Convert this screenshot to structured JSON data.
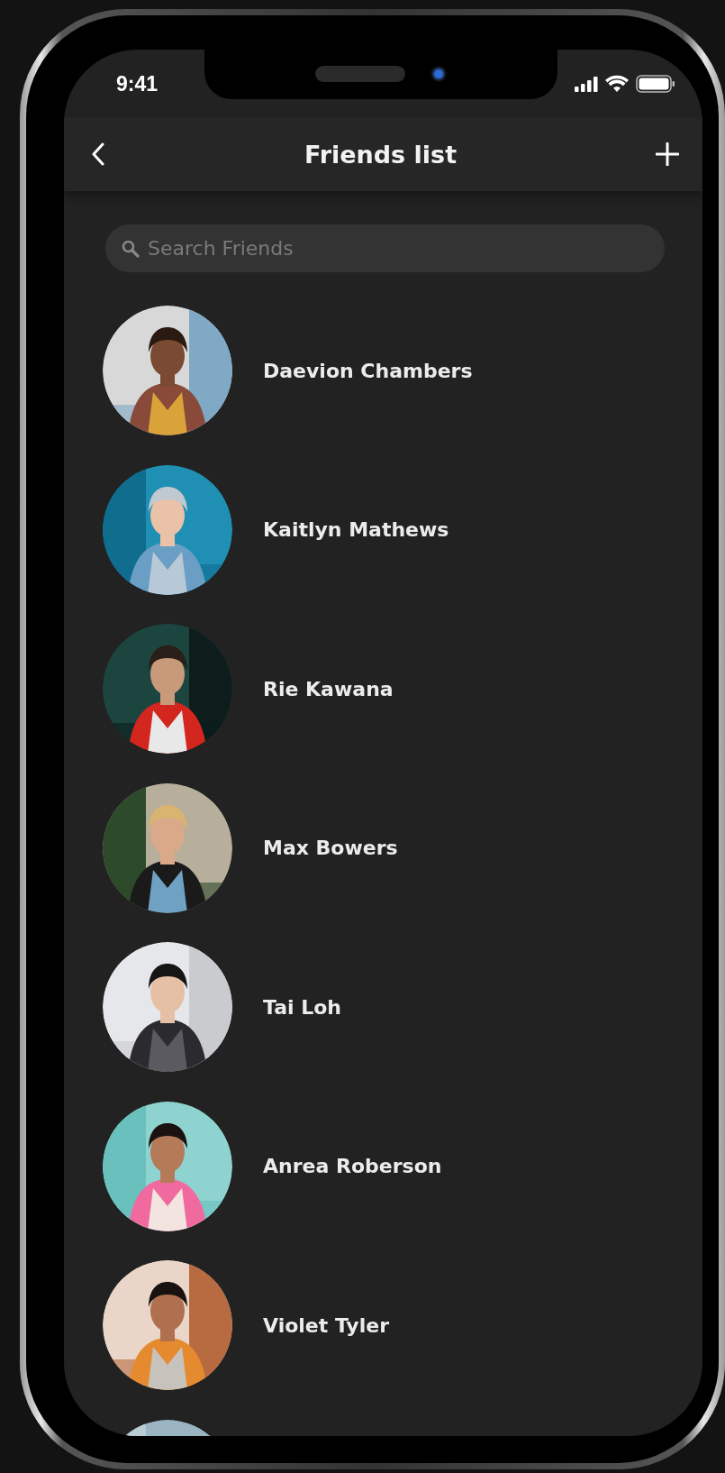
{
  "status_bar": {
    "time": "9:41"
  },
  "nav_bar": {
    "title": "Friends list"
  },
  "search": {
    "placeholder": "Search Friends"
  },
  "friends": [
    {
      "name": "Daevion Chambers",
      "kind": "picture"
    },
    {
      "name": "Kaitlyn Mathews",
      "kind": "picture"
    },
    {
      "name": "Rie Kawana",
      "kind": "picture"
    },
    {
      "name": "Max Bowers",
      "kind": "picture"
    },
    {
      "name": "Tai Loh",
      "kind": "picture"
    },
    {
      "name": "Anrea Roberson",
      "kind": "picture"
    },
    {
      "name": "Violet Tyler",
      "kind": "picture"
    },
    {
      "kind": "picture"
    }
  ]
}
